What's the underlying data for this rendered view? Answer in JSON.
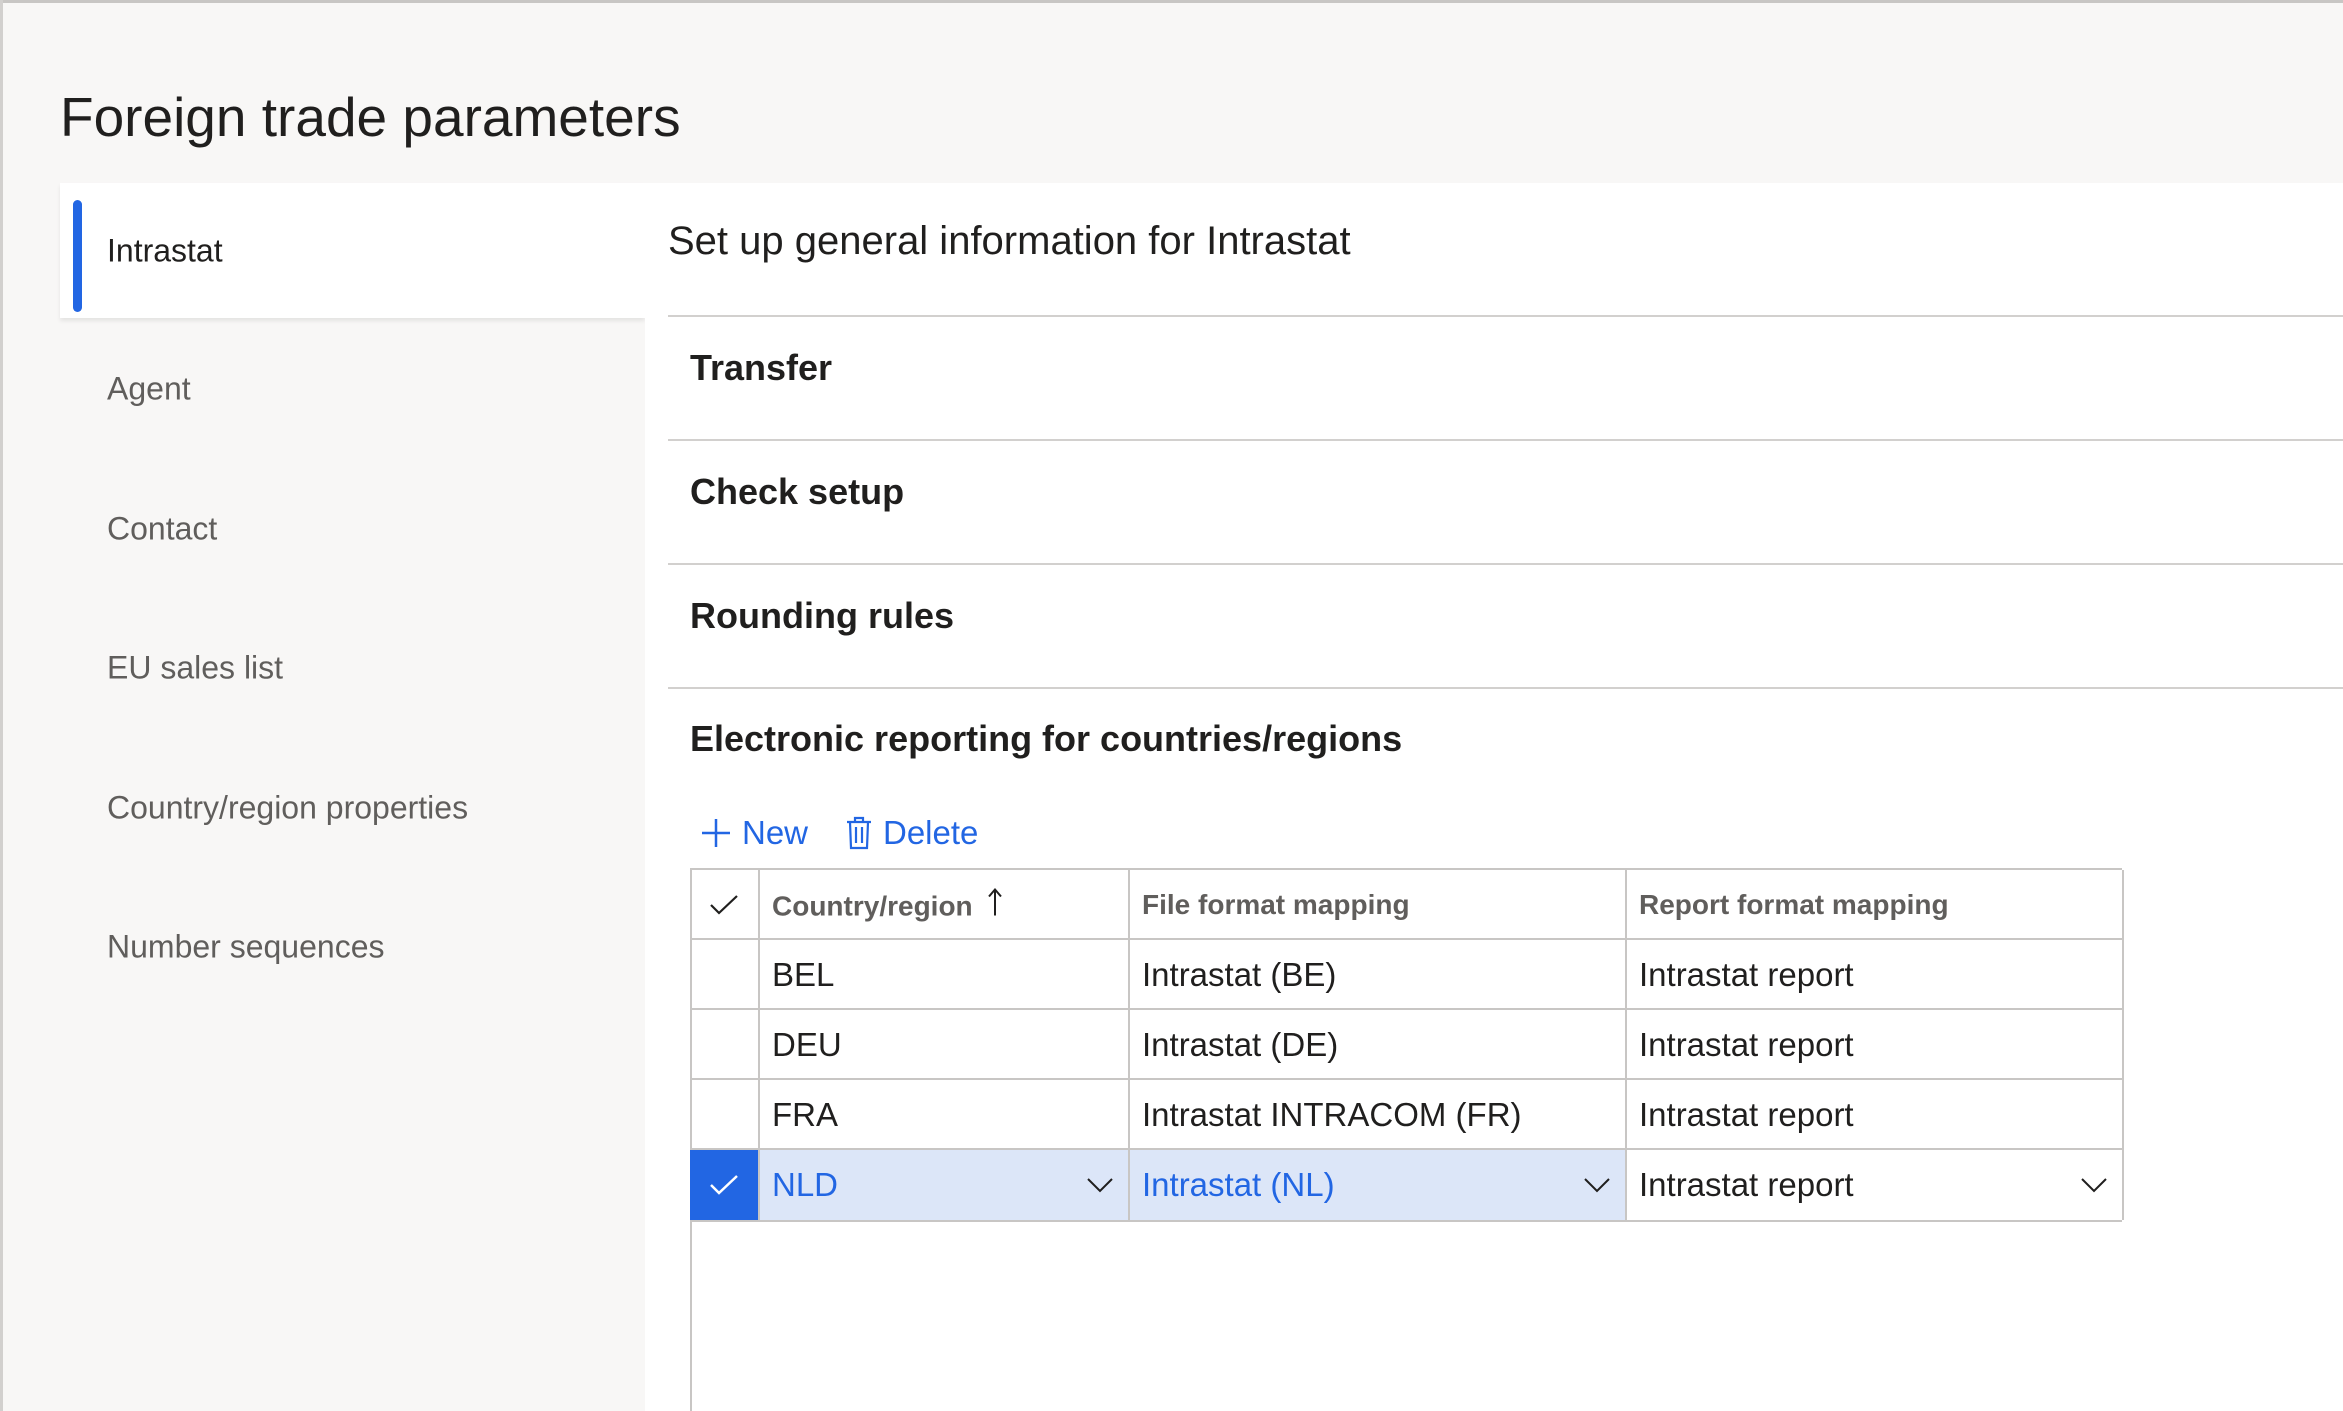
{
  "page": {
    "title": "Foreign trade parameters"
  },
  "nav": {
    "items": [
      {
        "label": "Intrastat",
        "active": true
      },
      {
        "label": "Agent"
      },
      {
        "label": "Contact"
      },
      {
        "label": "EU sales list"
      },
      {
        "label": "Country/region properties"
      },
      {
        "label": "Number sequences"
      }
    ]
  },
  "main": {
    "heading": "Set up general information for Intrastat",
    "fasttabs": [
      {
        "label": "Transfer"
      },
      {
        "label": "Check setup"
      },
      {
        "label": "Rounding rules"
      }
    ],
    "er_section": {
      "title": "Electronic reporting for countries/regions",
      "toolbar": {
        "new_label": "New",
        "delete_label": "Delete"
      },
      "grid": {
        "columns": [
          "Country/region",
          "File format mapping",
          "Report format mapping"
        ],
        "rows": [
          {
            "country": "BEL",
            "file_format": "Intrastat (BE)",
            "report_format": "Intrastat report",
            "selected": false
          },
          {
            "country": "DEU",
            "file_format": "Intrastat (DE)",
            "report_format": "Intrastat report",
            "selected": false
          },
          {
            "country": "FRA",
            "file_format": "Intrastat INTRACOM (FR)",
            "report_format": "Intrastat report",
            "selected": false
          },
          {
            "country": "NLD",
            "file_format": "Intrastat (NL)",
            "report_format": "Intrastat report",
            "selected": true
          }
        ]
      }
    }
  },
  "colors": {
    "accent": "#2266e3",
    "selected_row": "#dce6f8",
    "border": "#c8c6c4"
  },
  "icons": [
    "plus-icon",
    "trash-icon",
    "checkmark-icon",
    "sort-ascending-icon",
    "chevron-down-icon"
  ]
}
